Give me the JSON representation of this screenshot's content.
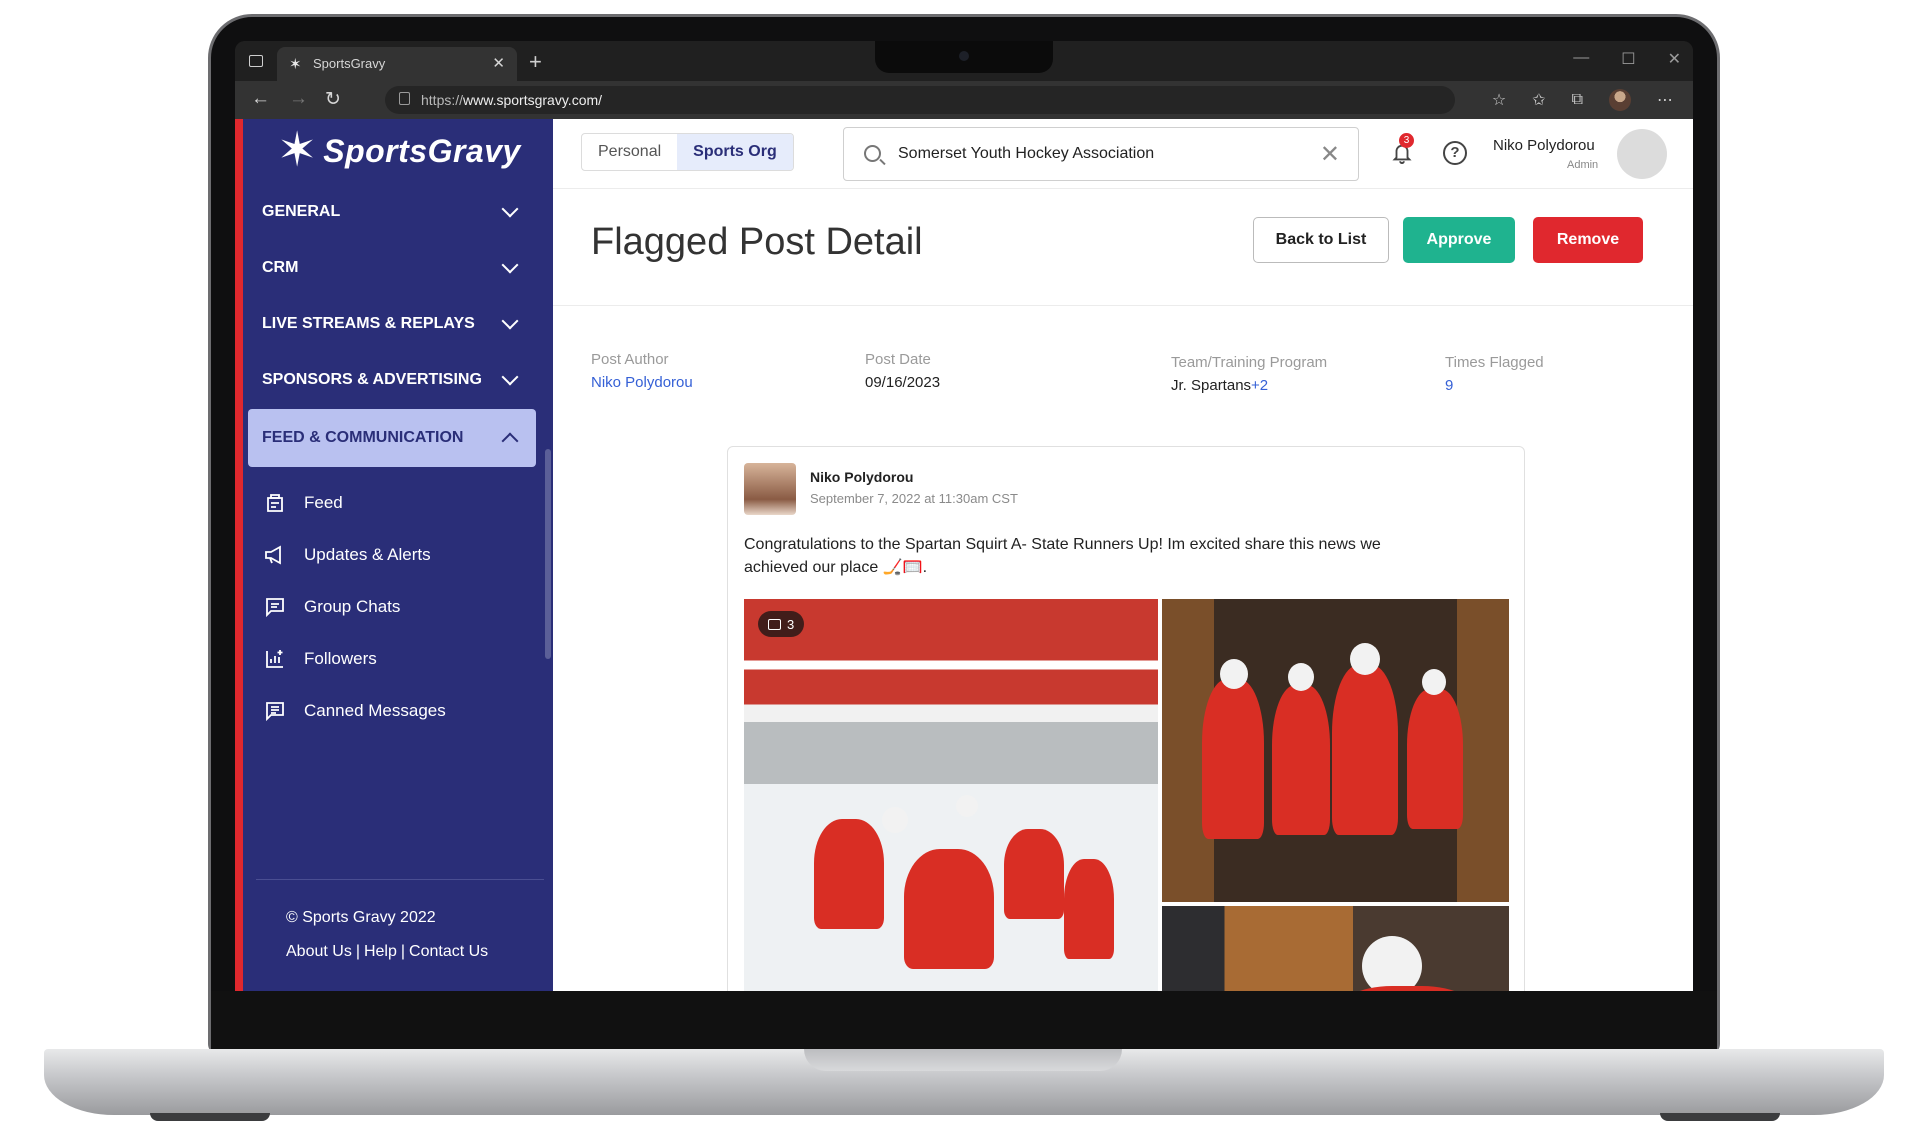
{
  "browser": {
    "tab_title": "SportsGravy",
    "url_scheme": "https://",
    "url_host": "www.sportsgravy.com/"
  },
  "sidebar": {
    "brand": "SportsGravy",
    "nav": [
      {
        "label": "GENERAL"
      },
      {
        "label": "CRM"
      },
      {
        "label": "LIVE STREAMS & REPLAYS"
      },
      {
        "label": "SPONSORS & ADVERTISING"
      },
      {
        "label": "FEED & COMMUNICATION"
      }
    ],
    "sub_items": [
      {
        "label": "Feed",
        "icon": "feed-icon"
      },
      {
        "label": "Updates & Alerts",
        "icon": "megaphone-icon"
      },
      {
        "label": "Group Chats",
        "icon": "chat-icon"
      },
      {
        "label": "Followers",
        "icon": "chart-plus-icon"
      },
      {
        "label": "Canned Messages",
        "icon": "message-icon"
      }
    ],
    "copyright": "© Sports Gravy 2022",
    "footer_links": [
      "About Us",
      "Help",
      "Contact Us"
    ]
  },
  "topbar": {
    "toggle": [
      "Personal",
      "Sports Org"
    ],
    "active_toggle": "Sports Org",
    "search_value": "Somerset Youth Hockey Association",
    "notification_count": "3",
    "help_glyph": "?",
    "user_name": "Niko Polydorou",
    "user_role": "Admin"
  },
  "page": {
    "title": "Flagged Post Detail",
    "back_label": "Back to List",
    "approve_label": "Approve",
    "remove_label": "Remove",
    "colors": {
      "approve": "#1fb38f",
      "remove": "#e0282e",
      "sidebar": "#2a2e78",
      "accent_red": "#e0282e"
    }
  },
  "meta": {
    "author_label": "Post Author",
    "author_value": "Niko Polydorou",
    "date_label": "Post Date",
    "date_value": "09/16/2023",
    "team_label": "Team/Training Program",
    "team_value": "Jr. Spartans",
    "team_more": "+2",
    "flagged_label": "Times Flagged",
    "flagged_value": "9"
  },
  "post": {
    "author": "Niko Polydorou",
    "date": "September 7, 2022 at 11:30am CST",
    "text": "Congratulations to the Spartan Squirt A- State Runners Up! Im excited share this news we achieved our place 🏒🥅.",
    "image_count": "3"
  }
}
